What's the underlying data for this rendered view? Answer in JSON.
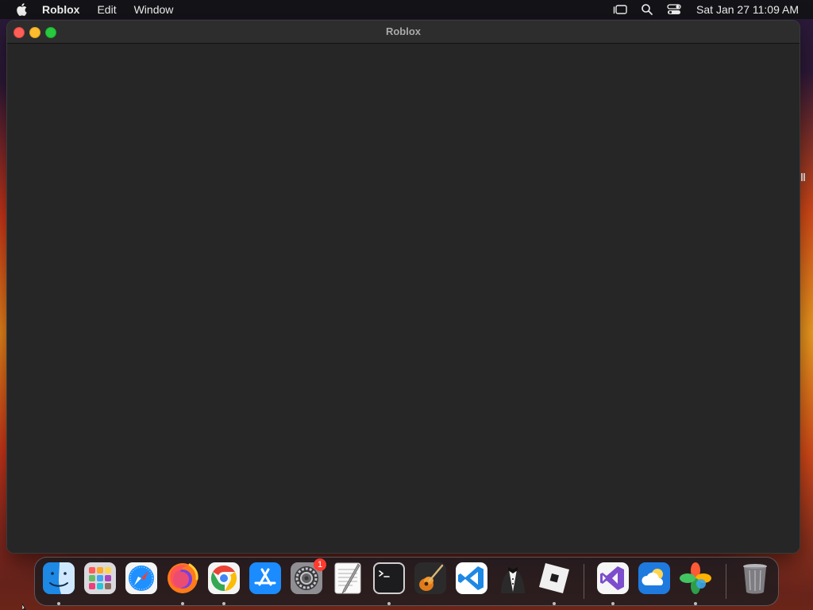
{
  "menubar": {
    "apple_icon": "apple-logo-icon",
    "items": [
      {
        "label": "Roblox",
        "bold": true
      },
      {
        "label": "Edit"
      },
      {
        "label": "Window"
      }
    ],
    "status_icons": [
      "stage-manager-icon",
      "spotlight-search-icon",
      "control-center-icon"
    ],
    "clock": "Sat Jan 27  11:09 AM"
  },
  "window": {
    "title": "Roblox",
    "content_background": "#262626"
  },
  "dock": {
    "apps": [
      {
        "name": "Finder",
        "icon": "finder-icon",
        "running": true
      },
      {
        "name": "Launchpad",
        "icon": "launchpad-icon",
        "running": false
      },
      {
        "name": "Safari",
        "icon": "safari-icon",
        "running": false
      },
      {
        "name": "Firefox",
        "icon": "firefox-icon",
        "running": true
      },
      {
        "name": "Google Chrome",
        "icon": "chrome-icon",
        "running": true
      },
      {
        "name": "App Store",
        "icon": "app-store-icon",
        "running": false
      },
      {
        "name": "System Settings",
        "icon": "system-settings-icon",
        "running": false,
        "badge": "1"
      },
      {
        "name": "TextEdit",
        "icon": "textedit-icon",
        "running": false
      },
      {
        "name": "Terminal",
        "icon": "terminal-icon",
        "running": true
      },
      {
        "name": "GarageBand",
        "icon": "garageband-icon",
        "running": false
      },
      {
        "name": "Visual Studio Code",
        "icon": "vscode-icon",
        "running": false
      },
      {
        "name": "Bartender",
        "icon": "bartender-icon",
        "running": false
      },
      {
        "name": "Roblox",
        "icon": "roblox-icon",
        "running": true
      },
      {
        "name": "Visual Studio",
        "icon": "visual-studio-icon",
        "running": true
      },
      {
        "name": "Weather",
        "icon": "weather-icon",
        "running": false
      },
      {
        "name": "Photos",
        "icon": "pinwheel-icon",
        "running": true
      },
      {
        "name": "Trash",
        "icon": "trash-icon",
        "running": false
      }
    ]
  },
  "colors": {
    "menubar": "#141418",
    "window_bg": "#262626",
    "close": "#ff5f57",
    "minimize": "#febc2e",
    "zoom": "#28c840"
  }
}
